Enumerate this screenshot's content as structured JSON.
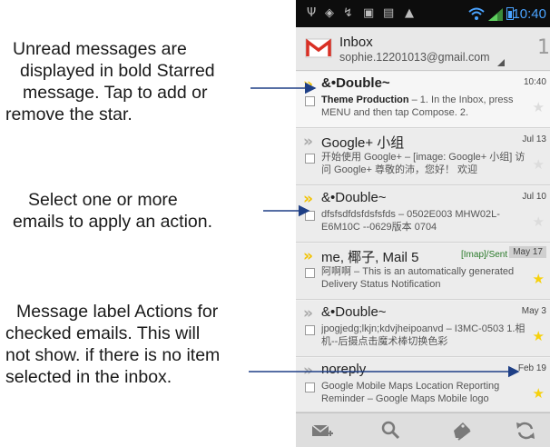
{
  "callouts": [
    {
      "lines": [
        "Unread messages are",
        "displayed in bold Starred",
        "message. Tap to add or",
        "remove the star."
      ]
    },
    {
      "lines": [
        "Select one or more",
        "emails to apply an action."
      ]
    },
    {
      "lines": [
        "Message label Actions for",
        "checked emails. This will",
        "not show. if there is no item",
        "selected in the inbox."
      ]
    }
  ],
  "status_bar": {
    "time": "10:40"
  },
  "header": {
    "title": "Inbox",
    "account": "sophie.12201013@gmail.com",
    "unread_count": "1"
  },
  "messages": [
    {
      "sender": "&•Double~",
      "bold": true,
      "important": true,
      "date": "10:40",
      "subject": "Theme Production",
      "snippet": " – 1. In the Inbox, press MENU and then tap Compose. 2.",
      "starred": false
    },
    {
      "sender": "Google+ 小组",
      "bold": false,
      "important": false,
      "date": "Jul 13",
      "subject": "",
      "snippet": "开始使用 Google+ – [image: Google+ 小组] 访问 Google+ 尊敬的沛，您好！ 欢迎",
      "starred": false
    },
    {
      "sender": "&•Double~",
      "bold": false,
      "important": true,
      "date": "Jul 10",
      "subject": "",
      "snippet": "dfsfsdfdsfdsfsfds – 0502E003 MHW02L-E6M10C --0629版本 0704",
      "starred": false
    },
    {
      "sender": "me, 椰子, Mail 5",
      "bold": false,
      "important": true,
      "date": "May 17",
      "label": "[Imap]/Sent",
      "subject": "",
      "snippet": "阿啊啊 – This is an automatically generated Delivery Status Notification",
      "starred": true
    },
    {
      "sender": "&•Double~",
      "bold": false,
      "important": false,
      "date": "May 3",
      "subject": "",
      "snippet": "jpogjedg;lkjn;kdvjheipoanvd – I3MC-0503 1.相机--后摄点击魔术棒切换色彩",
      "starred": true
    },
    {
      "sender": "noreply",
      "bold": false,
      "important": false,
      "date": "Feb 19",
      "subject": "",
      "snippet": "Google Mobile Maps Location Reporting Reminder – Google Maps Mobile logo",
      "starred": true
    }
  ],
  "bottom_bar": {
    "icons": [
      "compose-icon",
      "search-icon",
      "labels-icon",
      "refresh-icon"
    ]
  },
  "colors": {
    "star": "#f6d10c",
    "important": "#f2c200",
    "status_accent": "#4aa3ff",
    "gmail_red": "#d93025"
  }
}
